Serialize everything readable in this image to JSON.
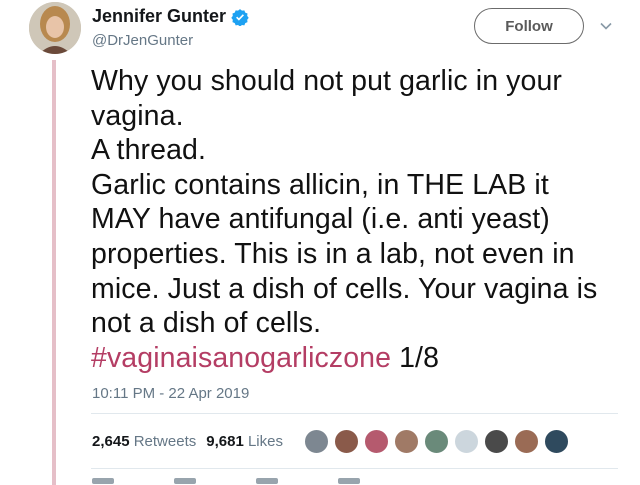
{
  "author": {
    "display_name": "Jennifer Gunter",
    "handle": "@DrJenGunter",
    "verified_icon": "verified-badge-icon",
    "avatar_icon": "avatar"
  },
  "follow_button": {
    "label": "Follow"
  },
  "menu": {
    "icon": "chevron-down-icon"
  },
  "tweet": {
    "lines": [
      "Why you should not put garlic in your",
      "vagina.",
      "A thread.",
      "Garlic contains allicin, in THE LAB it",
      "MAY have antifungal (i.e. anti yeast)",
      "properties. This is in a lab, not even in",
      "mice. Just a dish of cells. Your vagina is",
      "not a dish of cells."
    ],
    "hashtag": "#vaginaisanogarliczone",
    "thread_index": "1/8",
    "timestamp": "10:11 PM - 22 Apr 2019"
  },
  "stats": {
    "retweets_count": "2,645",
    "retweets_label": "Retweets",
    "likes_count": "9,681",
    "likes_label": "Likes"
  },
  "liker_avatar_colors": [
    "#7d8791",
    "#8a5a4a",
    "#b55a6e",
    "#a07a66",
    "#6a8a7a",
    "#ccd6dd",
    "#4a4a4a",
    "#9a6b55",
    "#2f4a5e"
  ],
  "colors": {
    "hashtag": "#b43d64",
    "verified": "#1da1f2",
    "thread_line": "#e5bfc8"
  }
}
